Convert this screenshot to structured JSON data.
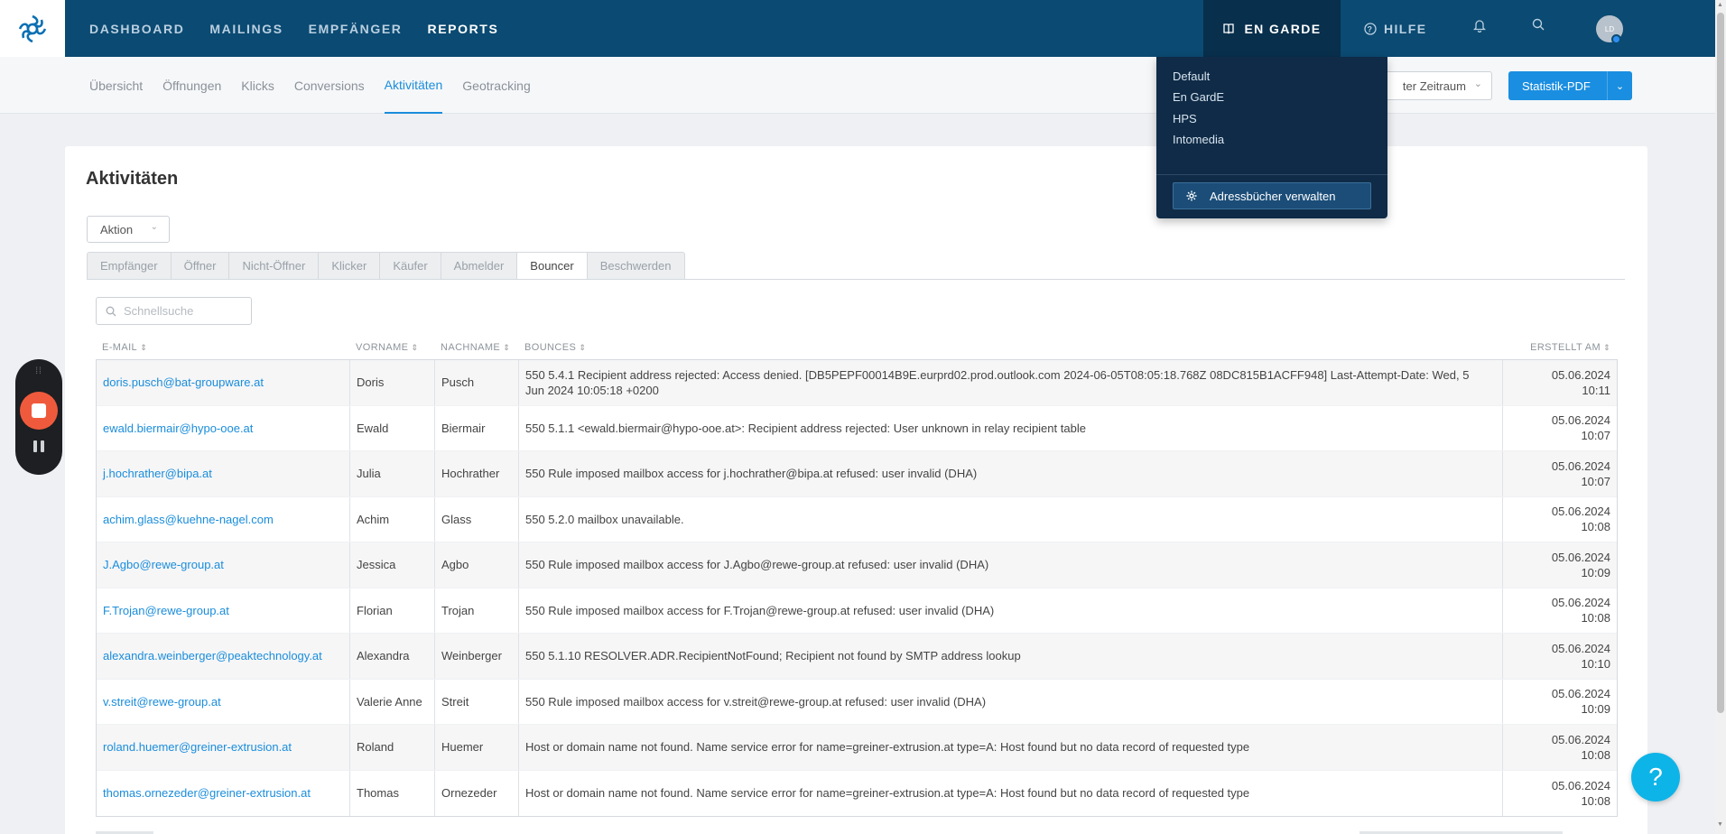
{
  "nav": {
    "items": [
      "DASHBOARD",
      "MAILINGS",
      "EMPFÄNGER",
      "REPORTS"
    ],
    "addressbook": "EN GARDE",
    "help": "HILFE",
    "avatar_initials": "LD"
  },
  "subnav": {
    "items": [
      "Übersicht",
      "Öffnungen",
      "Klicks",
      "Conversions",
      "Aktivitäten",
      "Geotracking"
    ],
    "zeitraum": "ter Zeitraum",
    "pdf_button": "Statistik-PDF"
  },
  "addressbook_menu": {
    "items": [
      "Default",
      "En GardE",
      "HPS",
      "Intomedia"
    ],
    "manage_button": "Adressbücher verwalten"
  },
  "page": {
    "title": "Aktivitäten",
    "action_select": "Aktion",
    "tabs": [
      "Empfänger",
      "Öffner",
      "Nicht-Öffner",
      "Klicker",
      "Käufer",
      "Abmelder",
      "Bouncer",
      "Beschwerden"
    ],
    "active_tab": "Bouncer",
    "search_placeholder": "Schnellsuche"
  },
  "table": {
    "headers": {
      "email": "E-MAIL",
      "first": "VORNAME",
      "last": "NACHNAME",
      "bounces": "BOUNCES",
      "created": "ERSTELLT AM"
    },
    "rows": [
      {
        "email": "doris.pusch@bat-groupware.at",
        "first": "Doris",
        "last": "Pusch",
        "bounce": "550 5.4.1 Recipient address rejected: Access denied. [DB5PEPF00014B9E.eurprd02.prod.outlook.com 2024-06-05T08:05:18.768Z 08DC815B1ACFF948] Last-Attempt-Date: Wed, 5 Jun 2024 10:05:18 +0200",
        "date": "05.06.2024",
        "time": "10:11"
      },
      {
        "email": "ewald.biermair@hypo-ooe.at",
        "first": "Ewald",
        "last": "Biermair",
        "bounce": "550 5.1.1 <ewald.biermair@hypo-ooe.at>: Recipient address rejected: User unknown in relay recipient table",
        "date": "05.06.2024",
        "time": "10:07"
      },
      {
        "email": "j.hochrather@bipa.at",
        "first": "Julia",
        "last": "Hochrather",
        "bounce": "550 Rule imposed mailbox access for j.hochrather@bipa.at refused: user invalid (DHA)",
        "date": "05.06.2024",
        "time": "10:07"
      },
      {
        "email": "achim.glass@kuehne-nagel.com",
        "first": "Achim",
        "last": "Glass",
        "bounce": "550 5.2.0 mailbox unavailable.",
        "date": "05.06.2024",
        "time": "10:08"
      },
      {
        "email": "J.Agbo@rewe-group.at",
        "first": "Jessica",
        "last": "Agbo",
        "bounce": "550 Rule imposed mailbox access for J.Agbo@rewe-group.at refused: user invalid (DHA)",
        "date": "05.06.2024",
        "time": "10:09"
      },
      {
        "email": "F.Trojan@rewe-group.at",
        "first": "Florian",
        "last": "Trojan",
        "bounce": "550 Rule imposed mailbox access for F.Trojan@rewe-group.at refused: user invalid (DHA)",
        "date": "05.06.2024",
        "time": "10:08"
      },
      {
        "email": "alexandra.weinberger@peaktechnology.at",
        "first": "Alexandra",
        "last": "Weinberger",
        "bounce": "550 5.1.10 RESOLVER.ADR.RecipientNotFound; Recipient not found by SMTP address lookup",
        "date": "05.06.2024",
        "time": "10:10"
      },
      {
        "email": "v.streit@rewe-group.at",
        "first": "Valerie Anne",
        "last": "Streit",
        "bounce": "550 Rule imposed mailbox access for v.streit@rewe-group.at refused: user invalid (DHA)",
        "date": "05.06.2024",
        "time": "10:09"
      },
      {
        "email": "roland.huemer@greiner-extrusion.at",
        "first": "Roland",
        "last": "Huemer",
        "bounce": "Host or domain name not found. Name service error for name=greiner-extrusion.at type=A: Host found but no data record of requested type",
        "date": "05.06.2024",
        "time": "10:08"
      },
      {
        "email": "thomas.ornezeder@greiner-extrusion.at",
        "first": "Thomas",
        "last": "Ornezeder",
        "bounce": "Host or domain name not found. Name service error for name=greiner-extrusion.at type=A: Host found but no data record of requested type",
        "date": "05.06.2024",
        "time": "10:08"
      }
    ]
  },
  "help_bubble": "?",
  "colors": {
    "nav_bg": "#0b4a72",
    "accent": "#1a8ddb",
    "dropdown_bg": "#0f2b47",
    "recorder_stop": "#f05a3c",
    "help_bubble": "#0db4e8"
  }
}
